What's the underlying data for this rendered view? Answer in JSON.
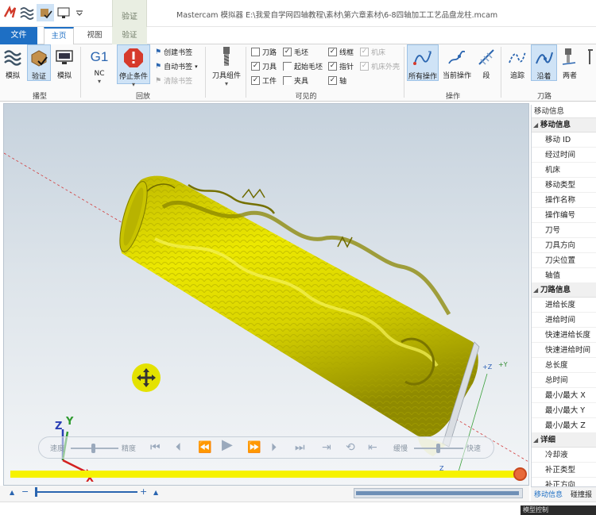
{
  "window": {
    "title": "Mastercam 模拟器  E:\\我爱自学网四轴教程\\素材\\第六章素材\\6-8四轴加工工艺品盘龙柱.mcam",
    "context_tab_top": "验证"
  },
  "tabs": {
    "file": "文件",
    "home": "主页",
    "view": "视图",
    "verify": "验证"
  },
  "ribbon": {
    "model": {
      "sim": "模拟",
      "verify": "验证",
      "simulate": "模拟",
      "group": "播型"
    },
    "stop": {
      "g1": "G1",
      "nc": "NC",
      "stop_condition": "停止条件",
      "create_bookmark": "创建书签",
      "auto_bookmark": "自动书签",
      "clear_bookmark": "清除书签",
      "group": "回放"
    },
    "visible": {
      "tool_component": "刀具组件",
      "items": {
        "toolpath": "刀路",
        "tool": "刀具",
        "workpiece": "工件",
        "stock": "毛坯",
        "start_stock": "起始毛坯",
        "fixture": "夹具",
        "wireframe": "线框",
        "axis_guide": "指针",
        "axis": "轴",
        "machine": "机床",
        "machine_housing": "机床外壳"
      },
      "group": "可见的"
    },
    "ops": {
      "all_ops": "所有操作",
      "current_op": "当前操作",
      "segment": "段",
      "trace": "追踪",
      "along": "沿着",
      "both": "两者",
      "group_ops": "操作",
      "group_path": "刀路"
    }
  },
  "playback": {
    "speed": "速度",
    "precision": "精度",
    "slow": "缓慢",
    "fast": "快速",
    "progress": 0.98
  },
  "axes": {
    "z": "Z",
    "y": "Y",
    "x": "X",
    "tool_z": "+Z",
    "tool_y": "+Y",
    "tool_z2": "Z"
  },
  "zoom": {
    "minus": "−",
    "plus": "+"
  },
  "panel": {
    "header": "移动信息",
    "sections": [
      {
        "title": "移动信息",
        "rows": [
          "移动 ID",
          "经过时间",
          "机床",
          "移动类型",
          "操作名称",
          "操作编号",
          "刀号",
          "刀具方向",
          "刀尖位置",
          "轴值"
        ]
      },
      {
        "title": "刀路信息",
        "rows": [
          "进给长度",
          "进给时间",
          "快速进给长度",
          "快速进给时间",
          "总长度",
          "总时间",
          "最小/最大 X",
          "最小/最大 Y",
          "最小/最大 Z"
        ]
      },
      {
        "title": "详细",
        "rows": [
          "冷却液",
          "补正类型",
          "补正方向"
        ]
      }
    ],
    "tab_move": "移动信息",
    "tab_collision": "碰撞报"
  },
  "status": {
    "right": "模型控制"
  },
  "colors": {
    "accent": "#1e6fc4",
    "part": "#d9d400",
    "progress": "#f6f200",
    "knob": "#e86a3a"
  }
}
